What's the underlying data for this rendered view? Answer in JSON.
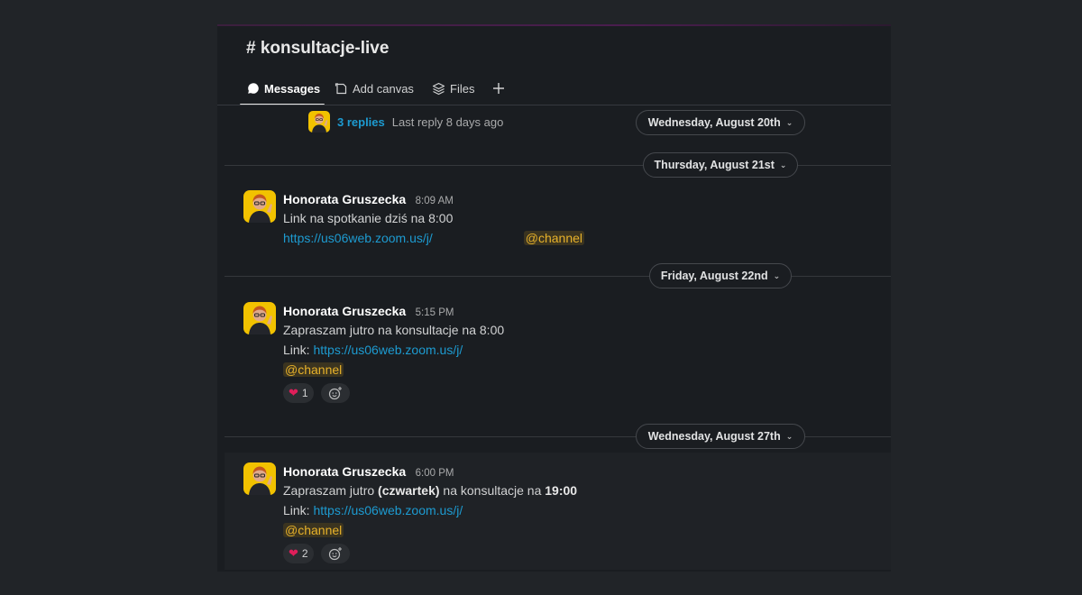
{
  "channel": {
    "title": "# konsultacje-live"
  },
  "tabs": [
    {
      "label": "Messages",
      "icon": "message-bubble-icon",
      "active": true
    },
    {
      "label": "Add canvas",
      "icon": "canvas-icon",
      "active": false
    },
    {
      "label": "Files",
      "icon": "layers-icon",
      "active": false
    },
    {
      "label": "",
      "icon": "plus-icon",
      "active": false
    }
  ],
  "thread": {
    "replies": "3 replies",
    "last_reply": "Last reply 8 days ago"
  },
  "dates": {
    "d1": "Wednesday, August 20th",
    "d2": "Thursday, August 21st",
    "d3": "Friday, August 22nd",
    "d4": "Wednesday, August 27th"
  },
  "messages": [
    {
      "author": "Honorata Gruszecka",
      "time": "8:09 AM",
      "line1": "Link na spotkanie dziś na 8:00",
      "link": "https://us06web.zoom.us/j/",
      "mention": "@channel"
    },
    {
      "author": "Honorata Gruszecka",
      "time": "5:15 PM",
      "line1": "Zapraszam jutro na konsultacje na 8:00",
      "link_prefix": "Link: ",
      "link": "https://us06web.zoom.us/j/",
      "mention": "@channel",
      "reaction_count": "1"
    },
    {
      "author": "Honorata Gruszecka",
      "time": "6:00 PM",
      "line1_a": "Zapraszam jutro ",
      "line1_b": "(czwartek)",
      "line1_c": " na konsultacje na ",
      "line1_d": "19:00",
      "link_prefix": "Link: ",
      "link": "https://us06web.zoom.us/j/",
      "mention": "@channel",
      "reaction_count": "2"
    }
  ],
  "colors": {
    "background": "#1a1d21",
    "link": "#1d9bd1",
    "mention": "#e8b22a",
    "reaction_heart": "#e01e5a"
  }
}
